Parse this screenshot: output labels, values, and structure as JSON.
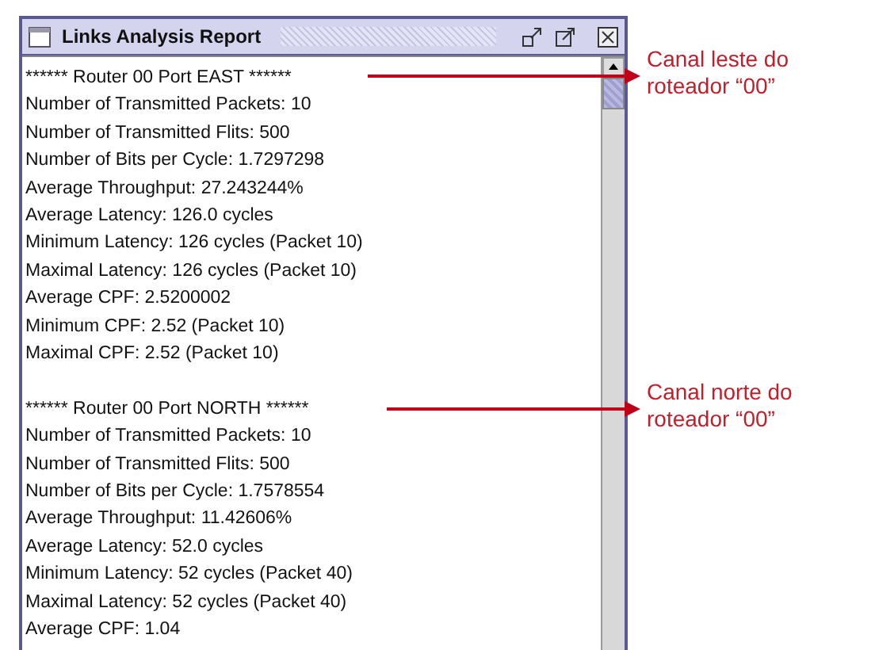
{
  "window": {
    "title": "Links Analysis Report"
  },
  "sections": [
    {
      "header": "****** Router 00 Port EAST ******",
      "lines": [
        "Number of Transmitted Packets: 10",
        "Number of Transmitted Flits: 500",
        "Number of Bits per Cycle: 1.7297298",
        "Average Throughput: 27.243244%",
        "Average Latency: 126.0 cycles",
        "Minimum Latency: 126 cycles (Packet 10)",
        "Maximal Latency: 126 cycles (Packet 10)",
        "Average CPF: 2.5200002",
        "Minimum CPF: 2.52 (Packet 10)",
        "Maximal CPF: 2.52 (Packet 10)"
      ],
      "annotation": [
        "Canal leste do",
        "roteador “00”"
      ]
    },
    {
      "header": "****** Router 00 Port NORTH ******",
      "lines": [
        "Number of Transmitted Packets: 10",
        "Number of Transmitted Flits: 500",
        "Number of Bits per Cycle: 1.7578554",
        "Average Throughput: 11.42606%",
        "Average Latency: 52.0 cycles",
        "Minimum Latency: 52 cycles (Packet 40)",
        "Maximal Latency: 52 cycles (Packet 40)",
        "Average CPF: 1.04"
      ],
      "annotation": [
        "Canal norte do",
        "roteador “00”"
      ]
    }
  ]
}
